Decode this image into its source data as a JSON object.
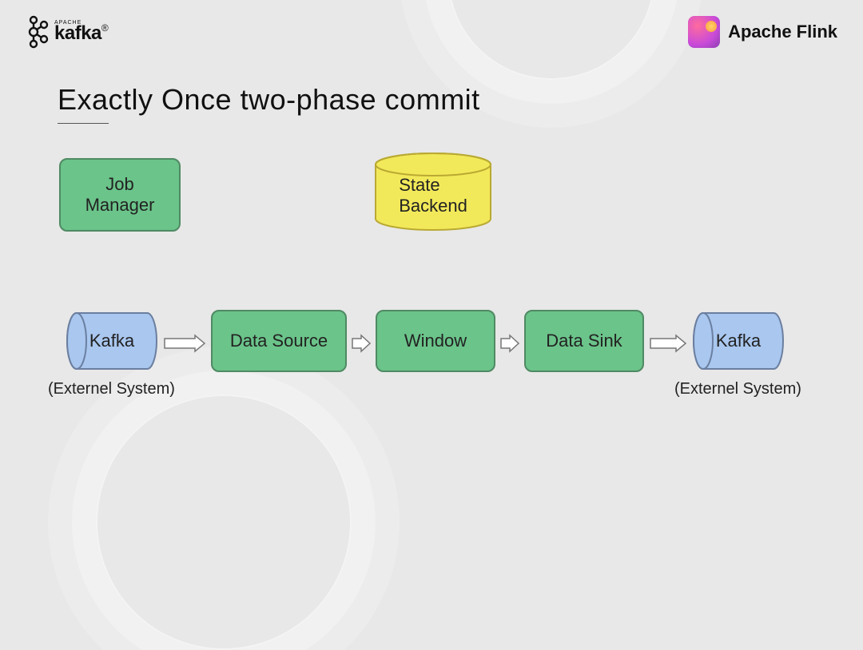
{
  "header": {
    "kafka_sup": "APACHE",
    "kafka_name": "kafka",
    "flink_name": "Apache Flink"
  },
  "title": "Exactly Once two-phase commit",
  "boxes": {
    "job_manager": "Job\nManager",
    "state_backend": "State\nBackend",
    "data_source": "Data Source",
    "window": "Window",
    "data_sink": "Data Sink"
  },
  "cylinders": {
    "kafka_left": "Kafka",
    "kafka_right": "Kafka"
  },
  "captions": {
    "left": "(Externel System)",
    "right": "(Externel System)"
  },
  "flow": [
    "kafka_left",
    "data_source",
    "window",
    "data_sink",
    "kafka_right"
  ]
}
